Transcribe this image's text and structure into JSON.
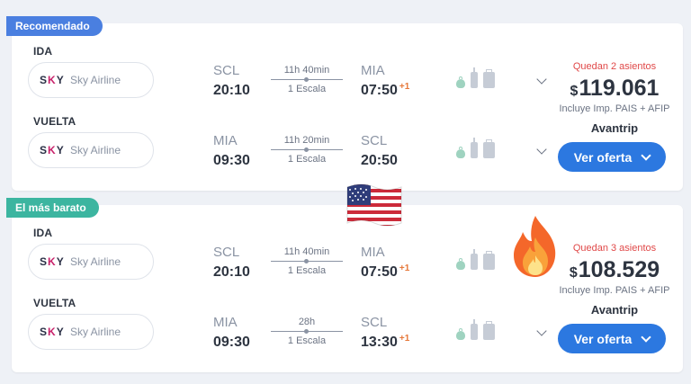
{
  "results": [
    {
      "badge": "Recomendado",
      "badge_color": "#4a7fe0",
      "segments": [
        {
          "direction": "IDA",
          "airline": "Sky Airline",
          "logo": "SKY",
          "from": "SCL",
          "dep_time": "20:10",
          "duration": "11h 40min",
          "stops": "1 Escala",
          "to": "MIA",
          "arr_time": "07:50",
          "day_offset": "+1"
        },
        {
          "direction": "VUELTA",
          "airline": "Sky Airline",
          "logo": "SKY",
          "from": "MIA",
          "dep_time": "09:30",
          "duration": "11h 20min",
          "stops": "1 Escala",
          "to": "SCL",
          "arr_time": "20:50",
          "day_offset": ""
        }
      ],
      "seats_left": "Quedan 2 asientos",
      "currency": "$",
      "price": "119.061",
      "tax_note": "Incluye Imp. PAIS + AFIP",
      "vendor": "Avantrip",
      "cta": "Ver oferta"
    },
    {
      "badge": "El más barato",
      "badge_color": "#3cb5a0",
      "segments": [
        {
          "direction": "IDA",
          "airline": "Sky Airline",
          "logo": "SKY",
          "from": "SCL",
          "dep_time": "20:10",
          "duration": "11h 40min",
          "stops": "1 Escala",
          "to": "MIA",
          "arr_time": "07:50",
          "day_offset": "+1"
        },
        {
          "direction": "VUELTA",
          "airline": "Sky Airline",
          "logo": "SKY",
          "from": "MIA",
          "dep_time": "09:30",
          "duration": "28h",
          "stops": "1 Escala",
          "to": "SCL",
          "arr_time": "13:30",
          "day_offset": "+1"
        }
      ],
      "seats_left": "Quedan 3 asientos",
      "currency": "$",
      "price": "108.529",
      "tax_note": "Incluye Imp. PAIS + AFIP",
      "vendor": "Avantrip",
      "cta": "Ver oferta"
    }
  ],
  "icons": {
    "flag": "us-flag-icon",
    "fire": "fire-icon",
    "baggage": [
      "personal-item-icon",
      "carry-on-icon",
      "checked-bag-icon"
    ],
    "expand": "chevron-down-icon"
  }
}
